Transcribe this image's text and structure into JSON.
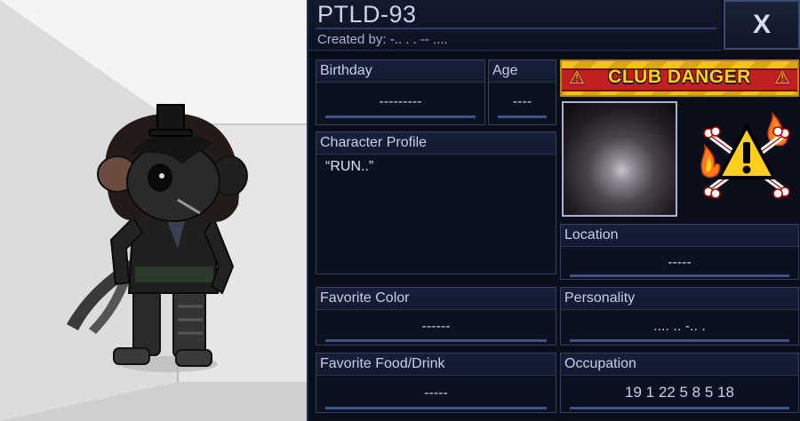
{
  "profile": {
    "title": "PTLD-93",
    "created_by": "Created by: -.. . . -- ....",
    "close_label": "X",
    "birthday": {
      "label": "Birthday",
      "value": "---------"
    },
    "age": {
      "label": "Age",
      "value": "----"
    },
    "character_profile": {
      "label": "Character Profile",
      "text": "“RUN..”"
    },
    "banner_text": "CLUB DANGER",
    "location": {
      "label": "Location",
      "value": "-----"
    },
    "favorite_color": {
      "label": "Favorite Color",
      "value": "------"
    },
    "personality": {
      "label": "Personality",
      "value": ".... ..  -..  ."
    },
    "favorite_food": {
      "label": "Favorite Food/Drink",
      "value": "-----"
    },
    "occupation": {
      "label": "Occupation",
      "value": "19 1 22 5 8 5 18"
    }
  },
  "colors": {
    "panel_bg": "#0a0e1a",
    "header_bg": "#18203a",
    "accent_line": "#3e5288",
    "banner_yellow": "#f2c41a",
    "banner_red": "#c21f1f"
  },
  "icons": [
    "close-icon",
    "warning-icon",
    "fire-icon",
    "crossbones-icon"
  ]
}
